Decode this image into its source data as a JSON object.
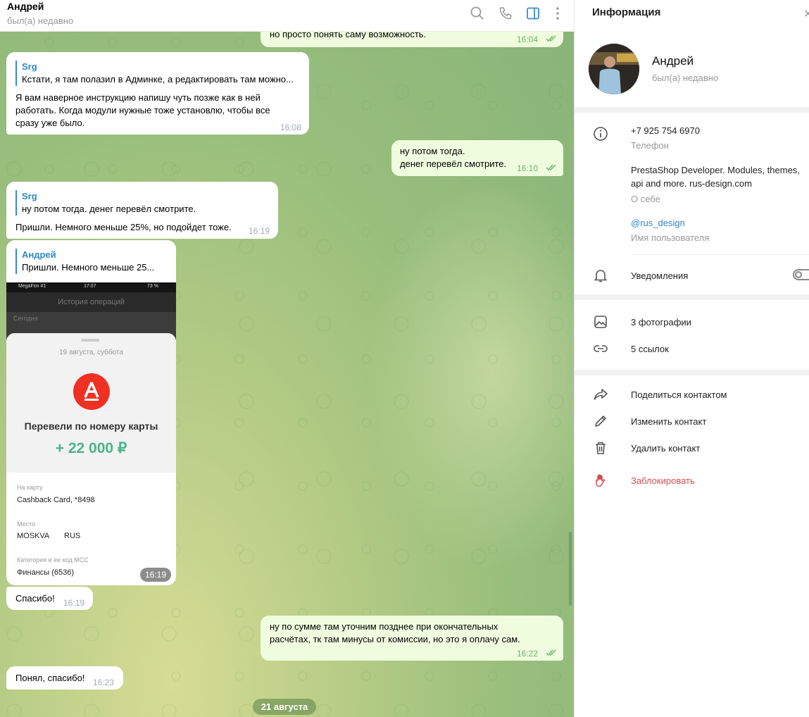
{
  "chat": {
    "name": "Андрей",
    "status": "был(а) недавно",
    "date_badge": "21 августа",
    "messages": [
      {
        "text": "но просто понять саму возможность.",
        "time": "16:04"
      },
      {
        "reply_name": "Srg",
        "reply_text": "Кстати, я там полазил в Админке, а редактировать там можно...",
        "lines": [
          "Я вам наверное инструкцию напишу чуть позже как в ней",
          "работать. Когда модули нужные тоже установлю, чтобы все",
          "сразу уже было."
        ],
        "time": "16:08"
      },
      {
        "lines": [
          "ну потом тогда.",
          "денег перевёл смотрите."
        ],
        "time": "16:10"
      },
      {
        "reply_name": "Srg",
        "reply_text": "ну потом тогда. денег перевёл смотрите.",
        "text": "Пришли. Немного меньше 25%, но подойдет тоже.",
        "time": "16:19"
      },
      {
        "reply_name": "Андрей",
        "reply_text": "Пришли. Немного меньше 25...",
        "time": "16:19"
      },
      {
        "text": "Спасибо!",
        "time": "16:19"
      },
      {
        "lines": [
          "ну по сумме там уточним позднее при окончательных",
          "расчётах, тк там минусы от комиссии, но это я оплачу сам."
        ],
        "time": "16:22"
      },
      {
        "text": "Понял, спасибо!",
        "time": "16:23"
      }
    ],
    "receipt": {
      "carrier": "MegaFon #1",
      "clock": "17:07",
      "battery": "73 %",
      "screen_title": "История операций",
      "today": "Сегодня",
      "date": "19 августа, суббота",
      "bank_letter": "А",
      "title": "Перевели по номеру карты",
      "amount": "+ 22 000 ₽",
      "card_label": "На карту",
      "card_value": "Cashback Card, *8498",
      "place_label": "Место",
      "place_city": "MOSKVA",
      "place_country": "RUS",
      "mcc_label": "Категория и ее код МСС",
      "mcc_value": "Финансы (6536)"
    }
  },
  "info": {
    "title": "Информация",
    "name": "Андрей",
    "status": "был(а) недавно",
    "phone": "+7 925 754 6970",
    "phone_label": "Телефон",
    "bio_lines": [
      "PrestaShop Developer. Modules, themes,",
      "api and more. rus-design.com"
    ],
    "bio_label": "О себе",
    "username": "@rus_design",
    "username_label": "Имя пользователя",
    "notifications": "Уведомления",
    "notifications_on": false,
    "photos": "3 фотографии",
    "links": "5 ссылок",
    "share": "Поделиться контактом",
    "edit": "Изменить контакт",
    "delete": "Удалить контакт",
    "block": "Заблокировать",
    "accent_color": "#2d86c5",
    "danger_color": "#d14e4e"
  },
  "icons": [
    "search-icon",
    "phone-icon",
    "sidebar-toggle-icon",
    "more-vertical-icon",
    "info-icon",
    "bell-icon",
    "photo-icon",
    "link-icon",
    "share-icon",
    "pencil-icon",
    "trash-icon",
    "hand-icon",
    "double-check-icon"
  ]
}
